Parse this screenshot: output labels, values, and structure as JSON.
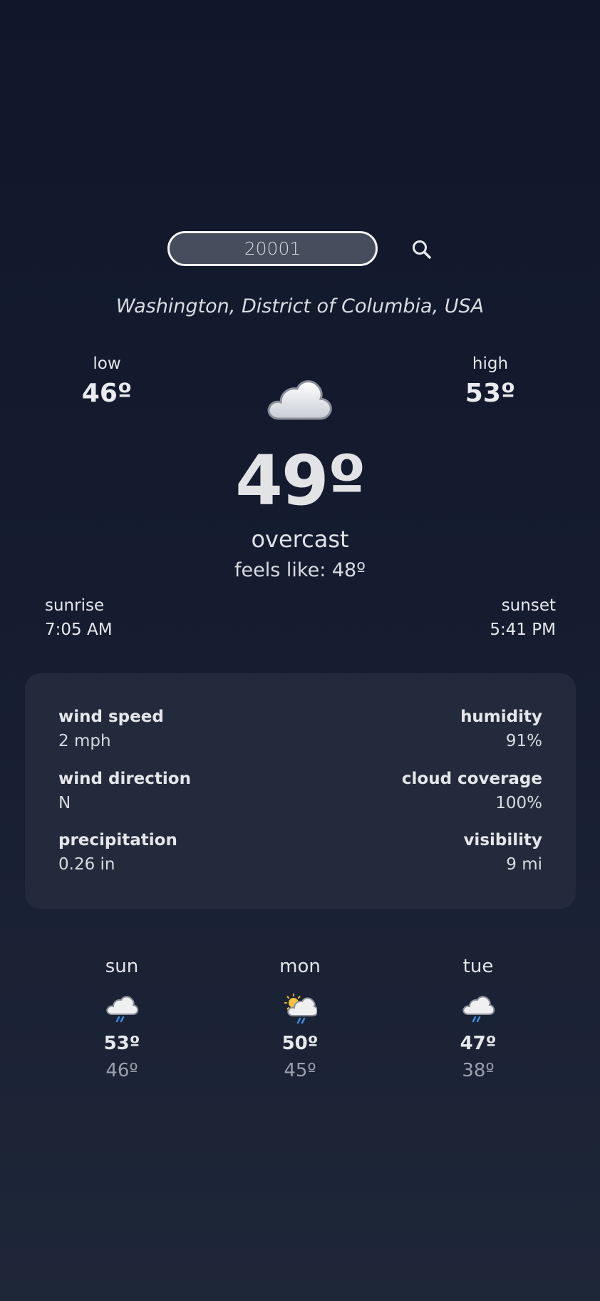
{
  "search": {
    "value": "20001",
    "button_icon": "search-icon"
  },
  "location": "Washington, District of Columbia, USA",
  "current": {
    "low_label": "low",
    "low_value": "46º",
    "high_label": "high",
    "high_value": "53º",
    "icon": "cloud-icon",
    "temperature": "49º",
    "condition": "overcast",
    "feels_like": "feels like: 48º"
  },
  "sun": {
    "sunrise_label": "sunrise",
    "sunrise_time": "7:05 AM",
    "sunset_label": "sunset",
    "sunset_time": "5:41 PM"
  },
  "details": {
    "wind_speed_label": "wind speed",
    "wind_speed_value": "2 mph",
    "humidity_label": "humidity",
    "humidity_value": "91%",
    "wind_direction_label": "wind direction",
    "wind_direction_value": "N",
    "cloud_coverage_label": "cloud coverage",
    "cloud_coverage_value": "100%",
    "precipitation_label": "precipitation",
    "precipitation_value": "0.26 in",
    "visibility_label": "visibility",
    "visibility_value": "9 mi"
  },
  "forecast": [
    {
      "day": "sun",
      "icon": "rain-cloud-icon",
      "high": "53º",
      "low": "46º"
    },
    {
      "day": "mon",
      "icon": "sun-rain-cloud-icon",
      "high": "50º",
      "low": "45º"
    },
    {
      "day": "tue",
      "icon": "rain-cloud-icon",
      "high": "47º",
      "low": "38º"
    }
  ],
  "colors": {
    "background_top": "#10172a",
    "background_bottom": "#1e2738",
    "card": "#222a3b",
    "input_fill": "#464d5c",
    "low_temp": "#9aa0ab",
    "rain_drop": "#3a8ee6",
    "sun": "#f5c23a"
  }
}
